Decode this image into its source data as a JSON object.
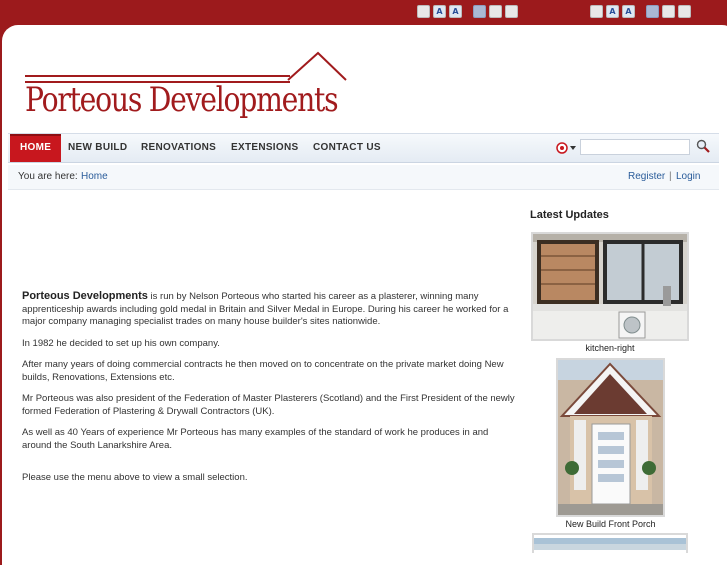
{
  "brand": {
    "name": "Porteous Developments",
    "color": "#a11b1d"
  },
  "topbar": {
    "left_buttons": [
      "A",
      "A"
    ],
    "right_buttons": [
      "A",
      "A"
    ]
  },
  "nav": {
    "items": [
      "HOME",
      "NEW BUILD",
      "RENOVATIONS",
      "EXTENSIONS",
      "CONTACT US"
    ],
    "active": "HOME"
  },
  "breadcrumb": {
    "label": "You are here:",
    "current": "Home"
  },
  "user_links": {
    "register": "Register",
    "separator": "|",
    "login": "Login"
  },
  "article": {
    "intro_strong": "Porteous Developments",
    "intro_rest": " is run by Nelson Porteous who started his career as a plasterer, winning many apprenticeship awards including gold medal in Britain and Silver Medal in Europe. During his career he worked for a major company managing specialist trades on many house builder's sites nationwide.",
    "p2": "In 1982 he decided to set up his own company.",
    "p3": "After many years of doing commercial contracts he then moved on to concentrate on the private market doing New builds, Renovations, Extensions etc.",
    "p4": "Mr Porteous was also president of the Federation of Master Plasterers (Scotland) and the First President of the newly formed Federation of Plastering & Drywall Contractors (UK).",
    "p5": "As well as 40 Years of experience Mr Porteous has many examples of the standard of work he produces in and around the South Lanarkshire Area.",
    "p6": "Please use the menu above to view a small selection."
  },
  "sidebar": {
    "title": "Latest Updates",
    "items": [
      {
        "caption": "kitchen-right"
      },
      {
        "caption": "New Build Front Porch"
      }
    ]
  }
}
